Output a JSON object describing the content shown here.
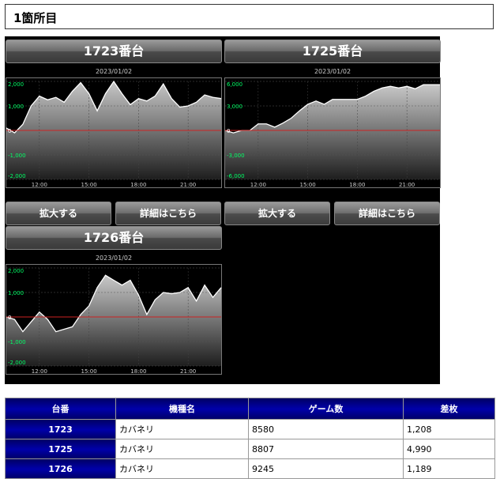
{
  "section_title": "1箇所目",
  "colors": {
    "axis_label": "#00ff66",
    "zero_line": "#cc2222",
    "area_top": "#c8c8c8",
    "area_bottom": "#1e1e1e",
    "line": "#ffffff"
  },
  "machines": [
    {
      "header": "1723番台",
      "date": "2023/01/02",
      "zoom_label": "拡大する",
      "detail_label": "詳細はこちら"
    },
    {
      "header": "1725番台",
      "date": "2023/01/02",
      "zoom_label": "拡大する",
      "detail_label": "詳細はこちら"
    },
    {
      "header": "1726番台",
      "date": "2023/01/02",
      "zoom_label": "",
      "detail_label": ""
    }
  ],
  "chart_data": [
    {
      "type": "area",
      "title": "2023/01/02",
      "x_ticks": [
        "12:00",
        "15:00",
        "18:00",
        "21:00"
      ],
      "y_ticks": [
        "2,000",
        "1,000",
        "0",
        "-1,000",
        "-2,000"
      ],
      "ylim": [
        -2000,
        2000
      ],
      "x_range": [
        10,
        23
      ],
      "x": [
        10.0,
        10.5,
        11.0,
        11.5,
        12.0,
        12.5,
        13.0,
        13.5,
        14.0,
        14.5,
        15.0,
        15.5,
        16.0,
        16.5,
        17.0,
        17.5,
        18.0,
        18.5,
        19.0,
        19.5,
        20.0,
        20.5,
        21.0,
        21.5,
        22.0,
        22.5,
        23.0
      ],
      "y": [
        100,
        -100,
        250,
        1000,
        1400,
        1250,
        1350,
        1150,
        1600,
        1950,
        1500,
        800,
        1500,
        2000,
        1500,
        1050,
        1300,
        1200,
        1400,
        1900,
        1300,
        950,
        1000,
        1150,
        1450,
        1350,
        1300
      ]
    },
    {
      "type": "area",
      "title": "2023/01/02",
      "x_ticks": [
        "12:00",
        "15:00",
        "18:00",
        "21:00"
      ],
      "y_ticks": [
        "6,000",
        "3,000",
        "0",
        "-3,000",
        "-6,000"
      ],
      "ylim": [
        -6000,
        6000
      ],
      "x_range": [
        10,
        23
      ],
      "x": [
        10.0,
        10.5,
        11.0,
        11.5,
        12.0,
        12.5,
        13.0,
        13.5,
        14.0,
        14.5,
        15.0,
        15.5,
        16.0,
        16.5,
        17.0,
        17.5,
        18.0,
        18.5,
        19.0,
        19.5,
        20.0,
        20.5,
        21.0,
        21.5,
        22.0,
        22.5,
        23.0
      ],
      "y": [
        0,
        -300,
        0,
        0,
        800,
        800,
        400,
        900,
        1500,
        2400,
        3200,
        3600,
        3200,
        3800,
        3800,
        3800,
        3800,
        4200,
        4800,
        5200,
        5400,
        5200,
        5400,
        5100,
        5600,
        5600,
        5600
      ]
    },
    {
      "type": "area",
      "title": "2023/01/02",
      "x_ticks": [
        "12:00",
        "15:00",
        "18:00",
        "21:00"
      ],
      "y_ticks": [
        "2,000",
        "1,000",
        "0",
        "-1,000",
        "-2,000"
      ],
      "ylim": [
        -2000,
        2000
      ],
      "x_range": [
        10,
        23
      ],
      "x": [
        10.0,
        10.5,
        11.0,
        11.5,
        12.0,
        12.5,
        13.0,
        13.5,
        14.0,
        14.5,
        15.0,
        15.5,
        16.0,
        16.5,
        17.0,
        17.5,
        18.0,
        18.5,
        19.0,
        19.5,
        20.0,
        20.5,
        21.0,
        21.5,
        22.0,
        22.5,
        23.0
      ],
      "y": [
        0,
        -100,
        -600,
        -200,
        200,
        -100,
        -600,
        -500,
        -400,
        100,
        450,
        1200,
        1700,
        1500,
        1300,
        1500,
        900,
        100,
        700,
        1000,
        950,
        1000,
        1200,
        650,
        1300,
        800,
        1200
      ]
    }
  ],
  "table": {
    "headers": [
      "台番",
      "機種名",
      "ゲーム数",
      "差枚"
    ],
    "rows": [
      [
        "1723",
        "カバネリ",
        "8580",
        "1,208"
      ],
      [
        "1725",
        "カバネリ",
        "8807",
        "4,990"
      ],
      [
        "1726",
        "カバネリ",
        "9245",
        "1,189"
      ]
    ]
  }
}
